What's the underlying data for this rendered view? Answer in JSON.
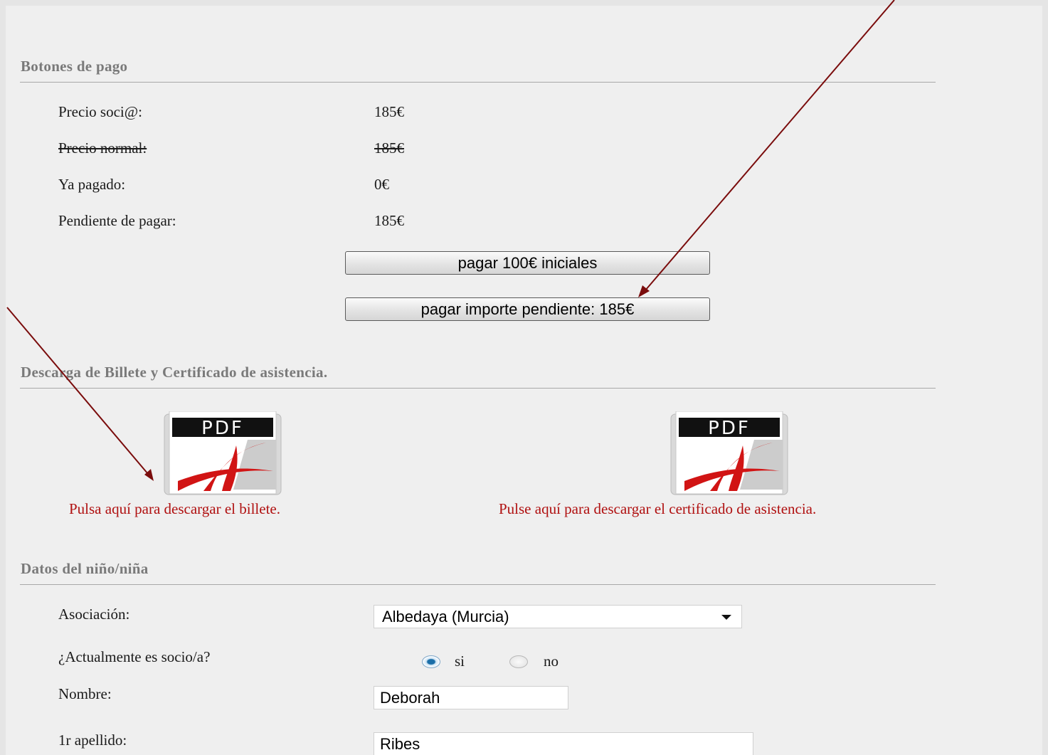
{
  "payment": {
    "title": "Botones de pago",
    "rows": [
      {
        "label": "Precio soci@:",
        "value": "185€"
      },
      {
        "label": "Precio normal:",
        "value": "185€"
      },
      {
        "label": "Ya pagado:",
        "value": "0€"
      },
      {
        "label": "Pendiente de pagar:",
        "value": "185€"
      }
    ],
    "pay_initial_label": "pagar 100€ iniciales",
    "pay_pending_label": "pagar importe pendiente: 185€"
  },
  "downloads": {
    "title": "Descarga de Billete y Certificado de asistencia.",
    "pdf_badge": "PDF",
    "ticket_link": "Pulsa aquí para descargar el billete.",
    "certificate_link": "Pulse aquí para descargar el certificado de asistencia."
  },
  "child": {
    "title": "Datos del niño/niña",
    "association_label": "Asociación:",
    "association_value": "Albedaya (Murcia)",
    "member_label": "¿Actualmente es socio/a?",
    "member_yes": "si",
    "member_no": "no",
    "member_selected": "si",
    "name_label": "Nombre:",
    "name_value": "Deborah",
    "surname_label": "1r apellido:",
    "surname_value": "Ribes"
  },
  "colors": {
    "annotation_arrow": "#7a0c0c",
    "link_red": "#b01010",
    "section_title_gray": "#7a7a7a"
  },
  "icons": [
    "pdf-file-icon",
    "dropdown-caret-icon",
    "annotation-arrow"
  ]
}
